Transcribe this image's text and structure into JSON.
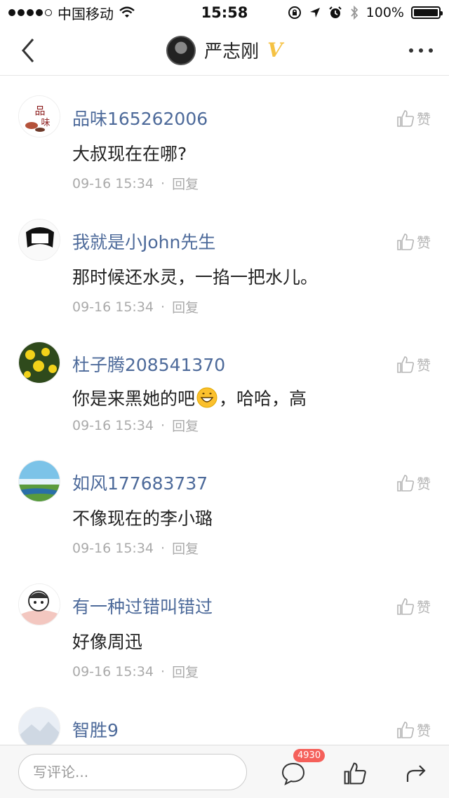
{
  "status_bar": {
    "carrier": "中国移动",
    "time": "15:58",
    "battery": "100%",
    "battery_level": 1.0
  },
  "nav": {
    "title": "严志刚",
    "verified_mark": "V",
    "back_icon": "chevron-left-icon",
    "more_icon": "more-icon"
  },
  "comments": [
    {
      "username": "品味165262006",
      "text": "大叔现在在哪?",
      "time": "09-16 15:34",
      "reply": "回复",
      "like": "赞"
    },
    {
      "username": "我就是小John先生",
      "text": "那时候还水灵，一掐一把水儿。",
      "time": "09-16 15:34",
      "reply": "回复",
      "like": "赞"
    },
    {
      "username": "杜子腾208541370",
      "text_before": "你是来黑她的吧",
      "text_after": "，哈哈，高",
      "emoji": "grinning-face-emoji",
      "time": "09-16 15:34",
      "reply": "回复",
      "like": "赞"
    },
    {
      "username": "如风177683737",
      "text": "不像现在的李小璐",
      "time": "09-16 15:34",
      "reply": "回复",
      "like": "赞"
    },
    {
      "username": "有一种过错叫错过",
      "text": "好像周迅",
      "time": "09-16 15:34",
      "reply": "回复",
      "like": "赞"
    },
    {
      "username": "智胜9",
      "like": "赞"
    }
  ],
  "bottom_bar": {
    "input_placeholder": "写评论...",
    "comment_count": "4930"
  },
  "colors": {
    "username": "#4d6a9a",
    "verified": "#f5c243",
    "badge": "#f5605a"
  }
}
